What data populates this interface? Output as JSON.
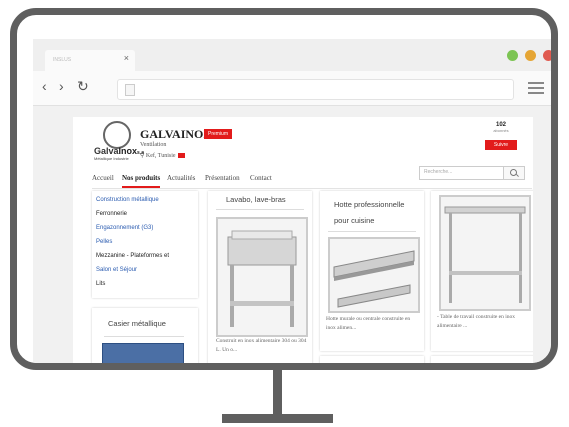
{
  "browser": {
    "tab_title": "INSLUS",
    "tab_close": "×",
    "back": "‹",
    "forward": "›",
    "reload": "↻"
  },
  "company": {
    "logo_text_left": "Galva",
    "logo_text_right": "Inox",
    "logo_suffix": "s.a",
    "logo_sub": "Métallique Industrie",
    "name": "GALVAINOX",
    "badge": "Premium",
    "category": "Ventilation",
    "location": "Kef, Tunisie",
    "followers_count": "102",
    "followers_label": "abonnés",
    "follow_label": "Suivre"
  },
  "menu": {
    "items": [
      "Accueil",
      "Nos produits",
      "Actualités",
      "Présentation",
      "Contact"
    ],
    "active_index": 1,
    "search_placeholder": "Recherche..."
  },
  "sidebar": {
    "categories": [
      {
        "label": "Construction métallique",
        "color": "blue"
      },
      {
        "label": "Ferronnerie",
        "color": "dark"
      },
      {
        "label": "Engazonnement (G3)",
        "color": "blue"
      },
      {
        "label": "Pelles",
        "color": "blue"
      },
      {
        "label": "Mezzanine - Plateformes et",
        "color": "dark"
      },
      {
        "label": "Salon et Séjour",
        "color": "blue"
      },
      {
        "label": "Lits",
        "color": "dark"
      }
    ],
    "casier_title": "Casier métallique"
  },
  "products": [
    {
      "title": "Lavabo, lave-bras",
      "desc": "Construit en inox alimentaire 304 ou 304 L. Un o..."
    },
    {
      "title": "Hotte professionnelle pour cuisine",
      "desc": "Hotte murale ou centrale construite en inox alimen..."
    },
    {
      "title": "",
      "desc": "- Table de travail construite en inox alimentaire ..."
    }
  ],
  "colors": {
    "accent": "#e21b1b",
    "link": "#2a5bb0",
    "frame": "#5f5f5f"
  }
}
